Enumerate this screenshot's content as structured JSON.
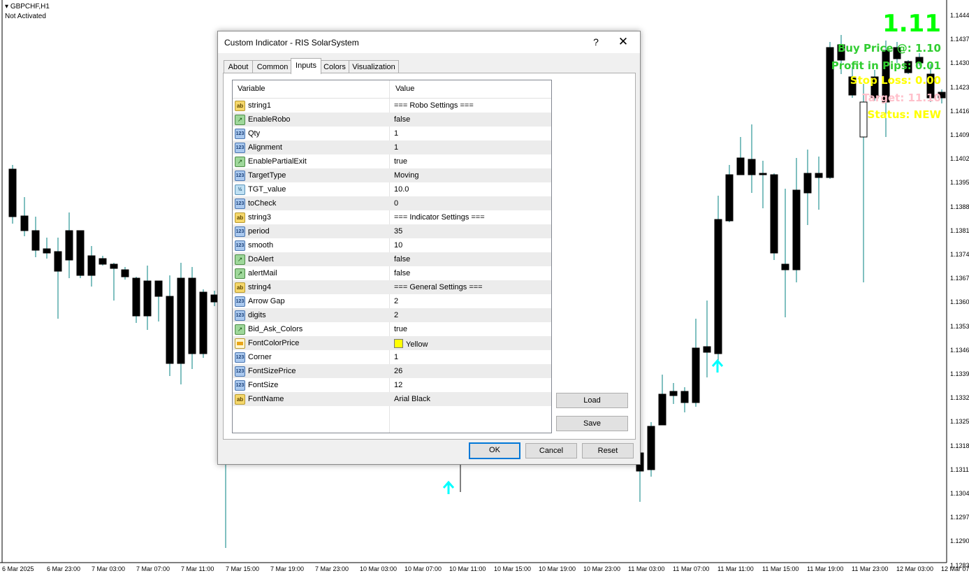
{
  "chart": {
    "symbol": "GBPCHF,H1",
    "status": "Not Activated",
    "price_levels": [
      "1.1444",
      "1.1437",
      "1.1430",
      "1.1423",
      "1.1416",
      "1.1409",
      "1.1402",
      "1.1395",
      "1.1388",
      "1.1381",
      "1.1374",
      "1.1367",
      "1.1360",
      "1.1353",
      "1.1346",
      "1.1339",
      "1.1332",
      "1.1325",
      "1.1318",
      "1.1311",
      "1.1304",
      "1.1297",
      "1.1290",
      "1.1283"
    ],
    "time_labels": [
      "6 Mar 2025",
      "6 Mar 23:00",
      "7 Mar 03:00",
      "7 Mar 07:00",
      "7 Mar 11:00",
      "7 Mar 15:00",
      "7 Mar 19:00",
      "7 Mar 23:00",
      "10 Mar 03:00",
      "10 Mar 07:00",
      "10 Mar 11:00",
      "10 Mar 15:00",
      "10 Mar 19:00",
      "10 Mar 23:00",
      "11 Mar 03:00",
      "11 Mar 07:00",
      "11 Mar 11:00",
      "11 Mar 15:00",
      "11 Mar 19:00",
      "11 Mar 23:00",
      "12 Mar 03:00",
      "12 Mar 07"
    ],
    "colors": {
      "bull_body": "#ffffff",
      "bear_body": "#000000",
      "wick": "#008080",
      "arrow": "#00ffff"
    }
  },
  "overlay": {
    "price": "1.11",
    "buy_price": "Buy Price @: 1.10",
    "profit": "Profit in Pips: 0.01",
    "stop_loss": "Stop Loss: 0.00",
    "target": "Target: 11.10",
    "status": "Status: NEW",
    "colors": {
      "price": "#00ff00",
      "buy": "#32cd32",
      "profit": "#32cd32",
      "stop": "#ffff00",
      "target": "#ffc0cb",
      "status": "#ffff00"
    }
  },
  "dialog": {
    "title": "Custom Indicator - RIS SolarSystem",
    "help": "?",
    "close": "✕",
    "tabs": [
      {
        "label": "About"
      },
      {
        "label": "Common"
      },
      {
        "label": "Inputs"
      },
      {
        "label": "Colors"
      },
      {
        "label": "Visualization"
      }
    ],
    "active_tab": "Inputs",
    "columns": {
      "variable": "Variable",
      "value": "Value"
    },
    "rows": [
      {
        "type": "ab",
        "name": "string1",
        "value": "=== Robo Settings ==="
      },
      {
        "type": "bool",
        "name": "EnableRobo",
        "value": "false"
      },
      {
        "type": "int",
        "name": "Qty",
        "value": "1"
      },
      {
        "type": "int",
        "name": "Alignment",
        "value": "1"
      },
      {
        "type": "bool",
        "name": "EnablePartialExit",
        "value": "true"
      },
      {
        "type": "int",
        "name": "TargetType",
        "value": "Moving"
      },
      {
        "type": "dbl",
        "name": "TGT_value",
        "value": "10.0"
      },
      {
        "type": "int",
        "name": "toCheck",
        "value": "0"
      },
      {
        "type": "ab",
        "name": "string3",
        "value": "=== Indicator Settings ==="
      },
      {
        "type": "int",
        "name": "period",
        "value": "35"
      },
      {
        "type": "int",
        "name": "smooth",
        "value": "10"
      },
      {
        "type": "bool",
        "name": "DoAlert",
        "value": "false"
      },
      {
        "type": "bool",
        "name": "alertMail",
        "value": "false"
      },
      {
        "type": "ab",
        "name": "string4",
        "value": "=== General Settings ==="
      },
      {
        "type": "int",
        "name": "Arrow Gap",
        "value": "2"
      },
      {
        "type": "int",
        "name": "digits",
        "value": "2"
      },
      {
        "type": "bool",
        "name": "Bid_Ask_Colors",
        "value": "true"
      },
      {
        "type": "clr",
        "name": "FontColorPrice",
        "value": "Yellow"
      },
      {
        "type": "int",
        "name": "Corner",
        "value": "1"
      },
      {
        "type": "int",
        "name": "FontSizePrice",
        "value": "26"
      },
      {
        "type": "int",
        "name": "FontSize",
        "value": "12"
      },
      {
        "type": "ab",
        "name": "FontName",
        "value": "Arial Black"
      }
    ],
    "icon_text": {
      "ab": "ab",
      "bool": "↗",
      "int": "123",
      "dbl": "½",
      "clr": ""
    },
    "side_buttons": {
      "load": "Load",
      "save": "Save"
    },
    "footer_buttons": {
      "ok": "OK",
      "cancel": "Cancel",
      "reset": "Reset"
    }
  }
}
